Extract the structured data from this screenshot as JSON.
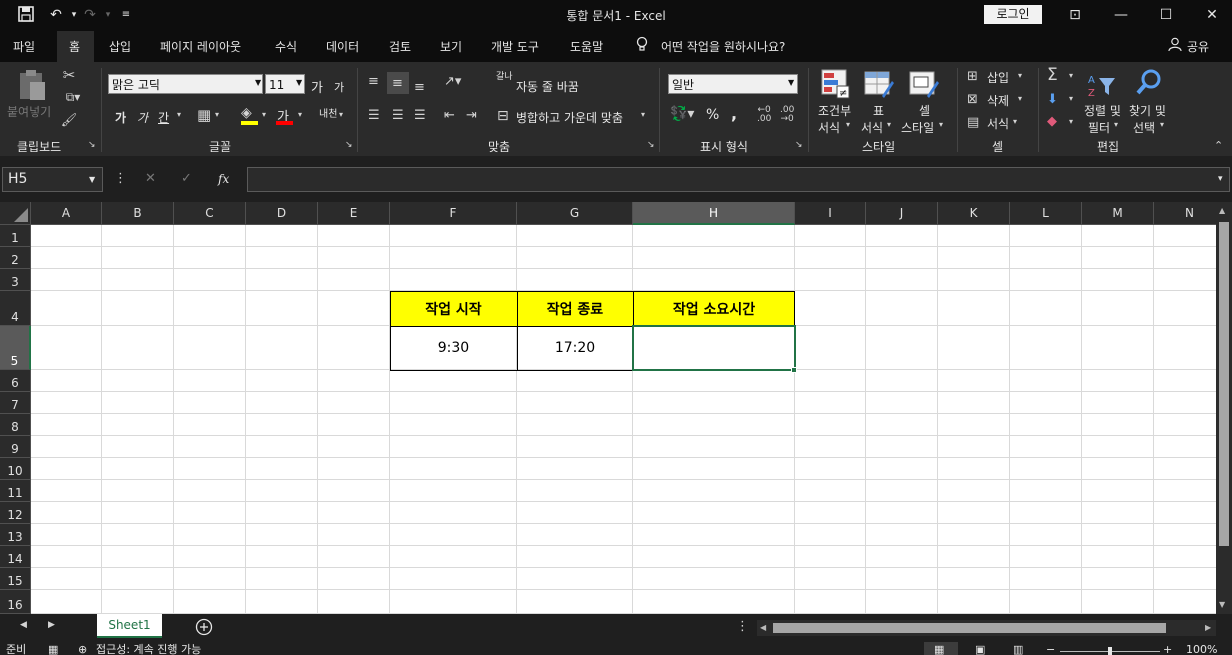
{
  "window": {
    "title": "통합 문서1  -  Excel",
    "login_label": "로그인"
  },
  "menu": [
    "파일",
    "홈",
    "삽입",
    "페이지 레이아웃",
    "수식",
    "데이터",
    "검토",
    "보기",
    "개발 도구",
    "도움말"
  ],
  "tell_me": "어떤 작업을 원하시나요?",
  "share": "공유",
  "ribbon": {
    "clipboard": {
      "label": "클립보드",
      "paste": "붙여넣기"
    },
    "font": {
      "label": "글꼴",
      "name": "맑은 고딕",
      "size": "11",
      "bold": "가",
      "italic": "가",
      "underline": "간",
      "grow": "가",
      "shrink": "가",
      "color_letter": "가",
      "phonetic": "내천"
    },
    "alignment": {
      "label": "맞춤",
      "wrap": "자동 줄 바꿈",
      "merge": "병합하고 가운데 맞춤",
      "wrap_icon": "갈나"
    },
    "number": {
      "label": "표시 형식",
      "format": "일반",
      "percent": "%",
      "comma": ","
    },
    "styles": {
      "label": "스타일",
      "conditional": "조건부 서식",
      "conditional_l1": "조건부",
      "conditional_l2": "서식",
      "table_l1": "표",
      "table_l2": "서식",
      "cell_l1": "셀",
      "cell_l2": "스타일"
    },
    "cells": {
      "label": "셀",
      "insert": "삽입",
      "delete": "삭제",
      "format": "서식"
    },
    "editing": {
      "label": "편집",
      "sort_l1": "정렬 및",
      "sort_l2": "필터",
      "find_l1": "찾기 및",
      "find_l2": "선택"
    }
  },
  "formula_bar": {
    "name_box": "H5",
    "fx": "fx",
    "value": ""
  },
  "columns": [
    "A",
    "B",
    "C",
    "D",
    "E",
    "F",
    "G",
    "H",
    "I",
    "J",
    "K",
    "L",
    "M",
    "N"
  ],
  "rows": [
    "1",
    "2",
    "3",
    "4",
    "5",
    "6",
    "7",
    "8",
    "9",
    "10",
    "11",
    "12",
    "13",
    "14",
    "15",
    "16"
  ],
  "table": {
    "headers": [
      "작업 시작",
      "작업 종료",
      "작업 소요시간"
    ],
    "values": [
      "9:30",
      "17:20",
      ""
    ]
  },
  "selected_cell": "H5",
  "sheet_tab": "Sheet1",
  "status": {
    "ready": "준비",
    "accessibility": "접근성: 계속 진행 가능",
    "zoom": "100%"
  },
  "colors": {
    "header_fill": "#ffff00",
    "accent": "#217346"
  }
}
